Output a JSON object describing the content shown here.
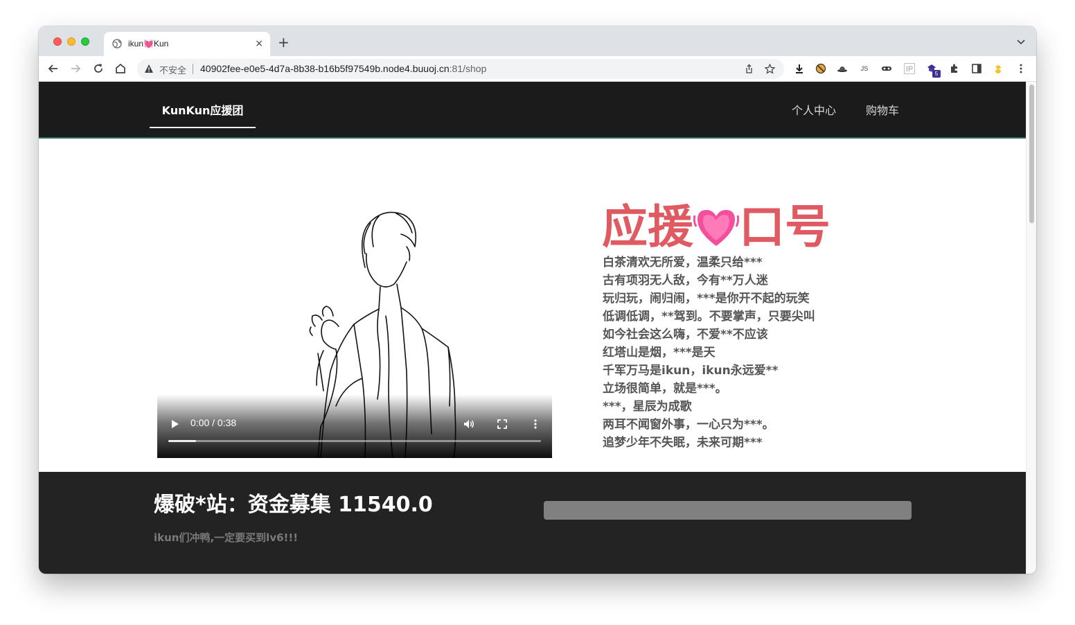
{
  "browser": {
    "tab_title": "ikun💓Kun",
    "new_tab_symbol": "+",
    "close_symbol": "×",
    "security_label": "不安全",
    "url_host": "40902fee-e0e5-4d7a-8b38-b16b5f97549b.node4.buuoj.cn",
    "url_port_path": ":81/shop",
    "extensions": [
      "download-icon",
      "block-icon",
      "hat-icon",
      "js-icon",
      "mask-icon",
      "ip-icon",
      "badge-icon",
      "puzzle-icon",
      "sidepanel-icon",
      "duck-icon",
      "menu-icon"
    ],
    "ext_ip_label": "IP",
    "ext_js_label": "JS",
    "ext_badge_count": "5"
  },
  "site": {
    "brand": "KunKun应援团",
    "nav": [
      {
        "label": "个人中心"
      },
      {
        "label": "购物车"
      }
    ]
  },
  "video": {
    "time": "0:00 / 0:38",
    "progress_fraction": 0,
    "buffered_fraction": 0.075
  },
  "slogan": {
    "title_left": "应援",
    "title_emoji": "💓",
    "title_right": "口号",
    "lines": [
      "白茶清欢无所爱，温柔只给***",
      "古有项羽无人敌，今有**万人迷",
      "玩归玩，闹归闹，***是你开不起的玩笑",
      "低调低调，**驾到。不要掌声，只要尖叫",
      "如今社会这么嗨，不爱**不应该",
      "红塔山是烟，***是天",
      "千军万马是ikun，ikun永远爱**",
      "立场很简单，就是***。",
      "***，星辰为成歌",
      "两耳不闻窗外事，一心只为***。",
      "追梦少年不失眠，未来可期***"
    ]
  },
  "fund": {
    "title": "爆破*站：资金募集 11540.0",
    "subtitle": "ikun们冲鸭,一定要买到lv6!!!",
    "progress_fraction": 0
  },
  "colors": {
    "slogan_title": "#e05a62",
    "nav_bg": "#1b1b1b",
    "fund_bg": "#232323",
    "fund_bar": "#808080"
  }
}
